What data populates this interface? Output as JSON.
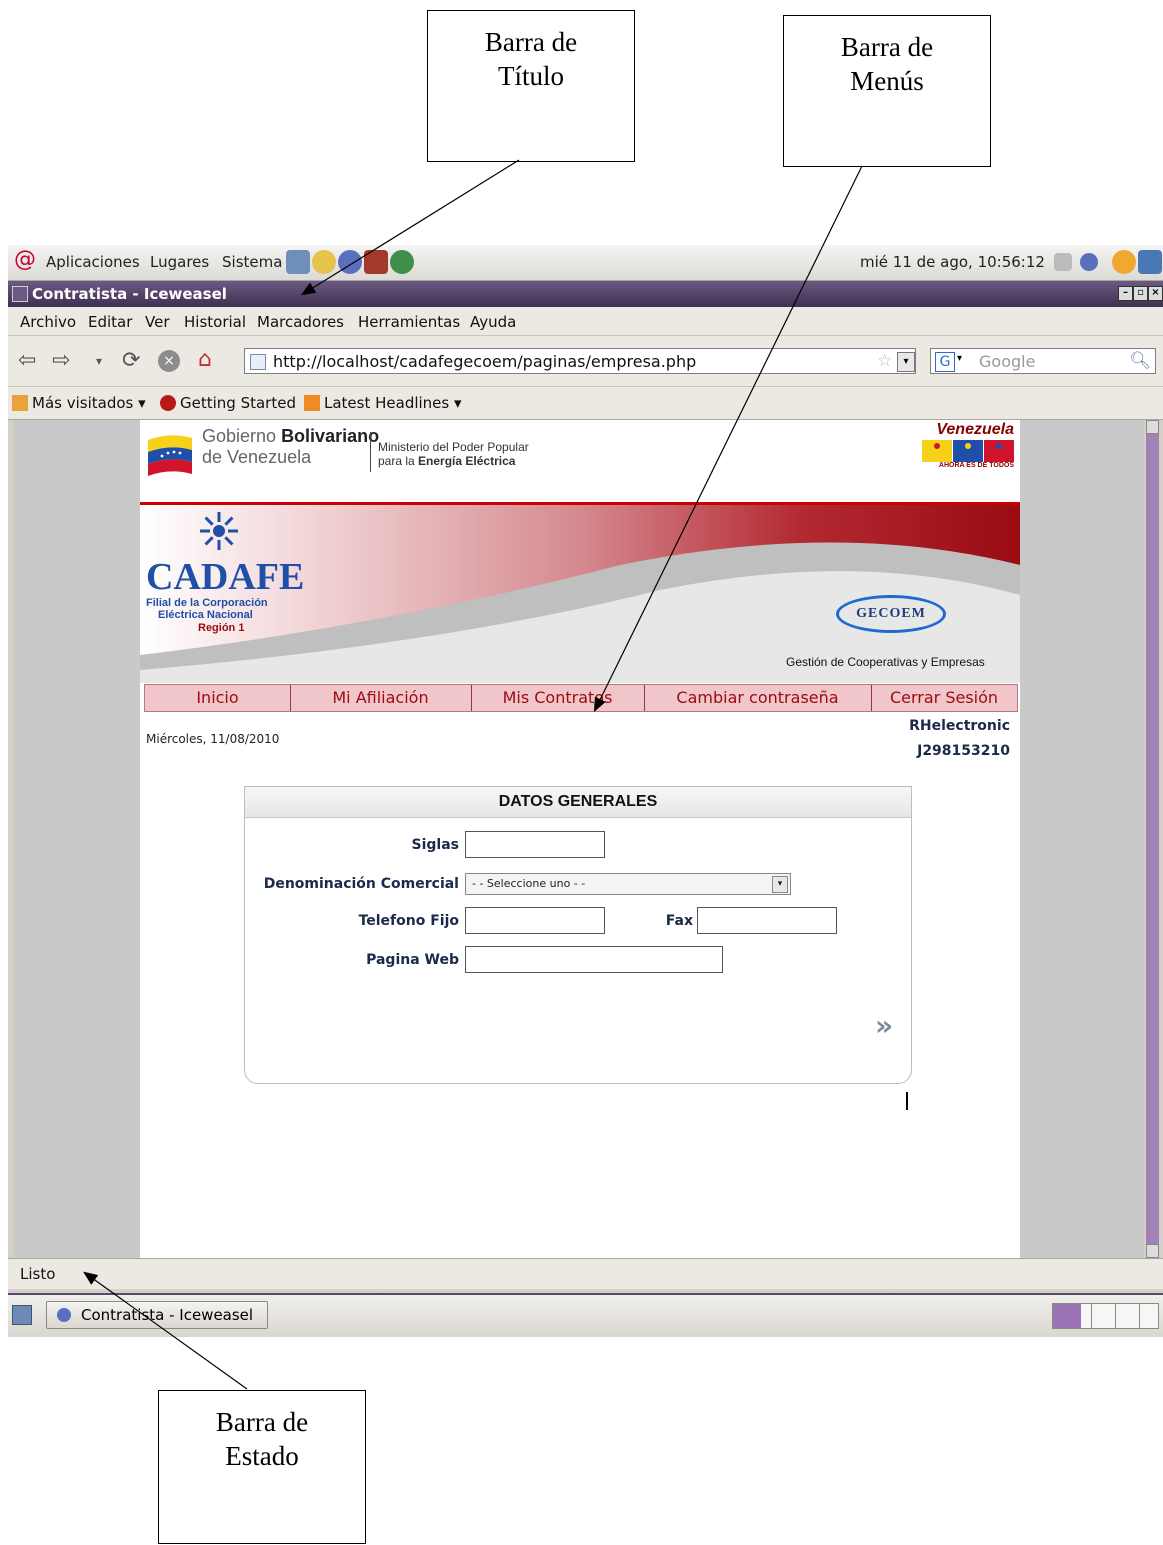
{
  "annotations": {
    "title_bar_label": [
      "Barra de",
      "Título"
    ],
    "menu_bar_label": [
      "Barra de",
      "Menús"
    ],
    "status_bar_label": [
      "Barra de",
      "Estado"
    ]
  },
  "gnome_panel": {
    "menus": [
      "Aplicaciones",
      "Lugares",
      "Sistema"
    ],
    "clock": "mié 11 de ago, 10:56:12"
  },
  "window": {
    "title": "Contratista - Iceweasel"
  },
  "browser": {
    "menu": [
      "Archivo",
      "Editar",
      "Ver",
      "Historial",
      "Marcadores",
      "Herramientas",
      "Ayuda"
    ],
    "url": "http://localhost/cadafegecoem/paginas/empresa.php",
    "search_placeholder": "Google",
    "bookmarks": [
      "Más visitados ▾",
      "Getting Started",
      "Latest Headlines ▾"
    ],
    "status": "Listo"
  },
  "page": {
    "gov": {
      "line1_prefix": "Gobierno ",
      "line1_bold": "Bolivariano",
      "line2": "de Venezuela",
      "ministry_line1": "Ministerio del Poder Popular",
      "ministry_line2_prefix": "para la ",
      "ministry_line2_bold": "Energía Eléctrica",
      "country": "Venezuela",
      "slogan": "AHORA ES DE TODOS"
    },
    "banner": {
      "brand": "CADAFE",
      "sub1": "Filial de la Corporación",
      "sub2": "Eléctrica Nacional",
      "region": "Región 1",
      "system_logo": "GECOEM",
      "system_caption": "Gestión de Cooperativas y Empresas"
    },
    "nav": [
      "Inicio",
      "Mi Afiliación",
      "Mis Contratos",
      "Cambiar contraseña",
      "Cerrar Sesión"
    ],
    "date": "Miércoles, 11/08/2010",
    "user": {
      "name": "RHelectronic",
      "id": "J298153210"
    },
    "form": {
      "header": "DATOS GENERALES",
      "siglas_label": "Siglas",
      "siglas_value": "",
      "denominacion_label": "Denominación Comercial",
      "denominacion_selected": "- - Seleccione uno - -",
      "telefono_label": "Telefono Fijo",
      "telefono_value": "",
      "fax_label": "Fax",
      "fax_value": "",
      "web_label": "Pagina Web",
      "web_value": ""
    }
  },
  "taskbar": {
    "task": "Contratista - Iceweasel"
  },
  "colors": {
    "accent_red": "#9a0b12",
    "cadafe_blue": "#1f4fa8",
    "title_purple": "#4a3a5f"
  }
}
